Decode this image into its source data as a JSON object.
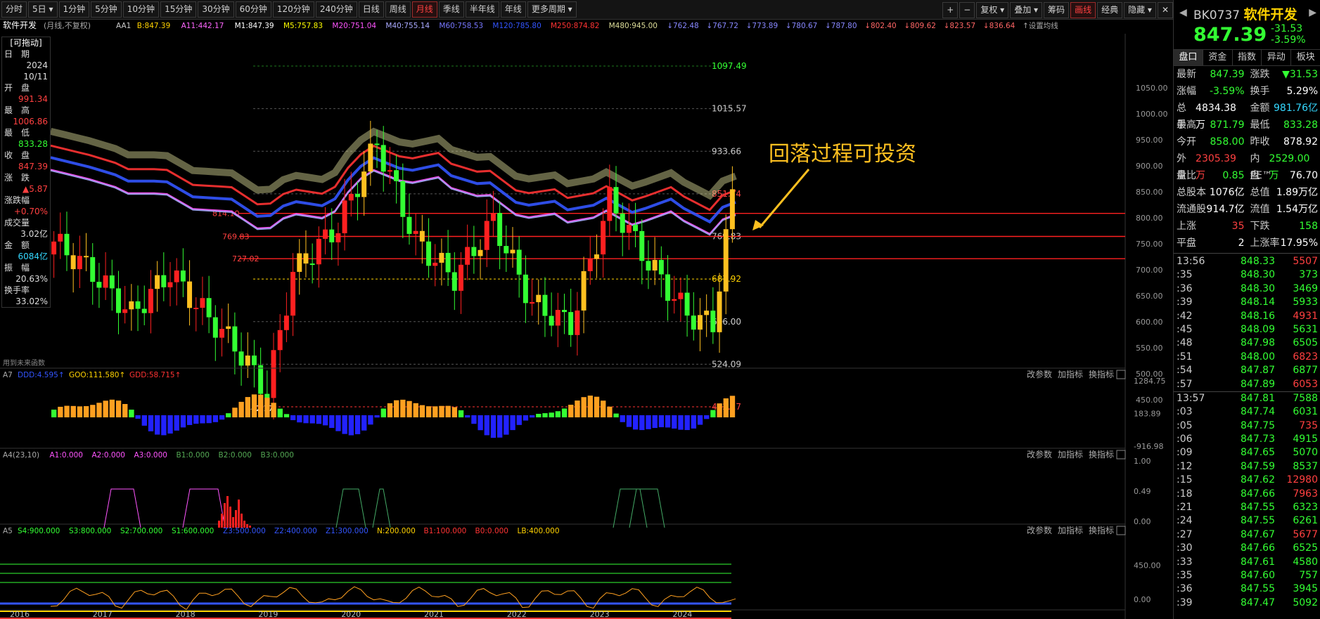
{
  "toolbar": {
    "periods": [
      "分时",
      "5日",
      "1分钟",
      "5分钟",
      "10分钟",
      "15分钟",
      "30分钟",
      "60分钟",
      "120分钟",
      "240分钟",
      "日线",
      "周线",
      "月线",
      "季线",
      "半年线",
      "年线",
      "更多周期"
    ],
    "active_period": "月线",
    "right_buttons": [
      "+",
      "−",
      "复权",
      "叠加",
      "筹码",
      "画线",
      "经典",
      "隐藏"
    ],
    "active_right": "画线"
  },
  "chart_header": {
    "name": "软件开发",
    "mode": "(月线,不复权)",
    "ma_items": [
      {
        "t": "AA1",
        "c": "#cccccc"
      },
      {
        "t": "B:847.39",
        "c": "#ffd200"
      },
      {
        "t": "A11:442.17",
        "c": "#ff66ff"
      },
      {
        "t": "M1:847.39",
        "c": "#ffffff"
      },
      {
        "t": "M5:757.83",
        "c": "#ffff00"
      },
      {
        "t": "M20:751.04",
        "c": "#ff55ff"
      },
      {
        "t": "M40:755.14",
        "c": "#aaaaff"
      },
      {
        "t": "M60:758.53",
        "c": "#7777ff"
      },
      {
        "t": "M120:785.80",
        "c": "#3355ff"
      },
      {
        "t": "M250:874.82",
        "c": "#ff3333"
      },
      {
        "t": "M480:945.00",
        "c": "#dddd99"
      },
      {
        "t": "↓762.48",
        "c": "#8888ff"
      },
      {
        "t": "↓767.72",
        "c": "#8888ff"
      },
      {
        "t": "↓773.89",
        "c": "#8888ff"
      },
      {
        "t": "↓780.67",
        "c": "#8888ff"
      },
      {
        "t": "↓787.80",
        "c": "#8888ff"
      },
      {
        "t": "↓802.40",
        "c": "#ff6666"
      },
      {
        "t": "↓809.62",
        "c": "#ff6666"
      },
      {
        "t": "↓823.57",
        "c": "#ff6666"
      },
      {
        "t": "↓836.64",
        "c": "#ff6666"
      },
      {
        "t": "↑设置均线",
        "c": "#aaaaaa"
      }
    ]
  },
  "infobox": {
    "title": "[可拖动]",
    "rows": [
      {
        "label": "日　期",
        "value": "2024",
        "value2": "10/11",
        "color": "#dddddd"
      },
      {
        "label": "开　盘",
        "value": "991.34",
        "color": "#ff4040"
      },
      {
        "label": "最　高",
        "value": "1006.86",
        "color": "#ff4040"
      },
      {
        "label": "最　低",
        "value": "833.28",
        "color": "#33ff33"
      },
      {
        "label": "收　盘",
        "value": "847.39",
        "color": "#ff4040"
      },
      {
        "label": "涨　跌",
        "value": "▲5.87",
        "color": "#ff4040"
      },
      {
        "label": "涨跌幅",
        "value": "+0.70%",
        "color": "#ff4040"
      },
      {
        "label": "成交量",
        "value": "3.02亿",
        "color": "#dddddd"
      },
      {
        "label": "金　额",
        "value": "6084亿",
        "color": "#34d8ff"
      },
      {
        "label": "振　幅",
        "value": "20.63%",
        "color": "#dddddd"
      },
      {
        "label": "换手率",
        "value": "33.02%",
        "color": "#dddddd"
      }
    ]
  },
  "main_chart": {
    "y_ticks": [
      "1050.00",
      "1000.00",
      "950.00",
      "900.00",
      "850.00",
      "800.00",
      "750.00",
      "700.00",
      "650.00",
      "600.00",
      "550.00",
      "500.00",
      "450.00"
    ],
    "price_labels": [
      "1097.49",
      "1015.57",
      "933.66",
      "851.74",
      "769.83",
      "687.92",
      "606.00",
      "524.09",
      "442.17"
    ],
    "left_levels": [
      "814.10",
      "769.83",
      "727.02"
    ],
    "low_marker": "442.17",
    "annotation": "回落过程可投资",
    "footnote": "用到未来函数"
  },
  "x_axis": [
    "2016",
    "2017",
    "2018",
    "2019",
    "2020",
    "2021",
    "2022",
    "2023",
    "2024"
  ],
  "panels": [
    {
      "name": "A7",
      "items": [
        {
          "t": "A7",
          "c": "#aaaaaa"
        },
        {
          "t": "DDD:4.595↑",
          "c": "#3355ff"
        },
        {
          "t": "GOO:111.580↑",
          "c": "#ffd200"
        },
        {
          "t": "GDD:58.715↑",
          "c": "#ff3333"
        }
      ],
      "y_ticks": [
        "1284.75",
        "183.89",
        "-916.98"
      ]
    },
    {
      "name": "A4",
      "items": [
        {
          "t": "A4(23,10)",
          "c": "#aaaaaa"
        },
        {
          "t": "A1:0.000",
          "c": "#ff55ff"
        },
        {
          "t": "A2:0.000",
          "c": "#ff55ff"
        },
        {
          "t": "A3:0.000",
          "c": "#ff55ff"
        },
        {
          "t": "B1:0.000",
          "c": "#55aa55"
        },
        {
          "t": "B2:0.000",
          "c": "#55aa55"
        },
        {
          "t": "B3:0.000",
          "c": "#55aa55"
        }
      ],
      "y_ticks": [
        "1.00",
        "0.49",
        "0.00"
      ]
    },
    {
      "name": "A5",
      "items": [
        {
          "t": "A5",
          "c": "#aaaaaa"
        },
        {
          "t": "S4:900.000",
          "c": "#33ff33"
        },
        {
          "t": "S3:800.000",
          "c": "#33ff33"
        },
        {
          "t": "S2:700.000",
          "c": "#33ff33"
        },
        {
          "t": "S1:600.000",
          "c": "#33ff33"
        },
        {
          "t": "Z3:500.000",
          "c": "#3355ff"
        },
        {
          "t": "Z2:400.000",
          "c": "#3355ff"
        },
        {
          "t": "Z1:300.000",
          "c": "#3355ff"
        },
        {
          "t": "N:200.000",
          "c": "#ffd200"
        },
        {
          "t": "B1:100.000",
          "c": "#ff3333"
        },
        {
          "t": "B0:0.000",
          "c": "#ff3333"
        },
        {
          "t": "LB:400.000",
          "c": "#ffd200"
        }
      ],
      "y_ticks": [
        "450.00",
        "0.00"
      ]
    }
  ],
  "panel_buttons": [
    "改参数",
    "加指标",
    "换指标"
  ],
  "quote": {
    "code": "BK0737",
    "name": "软件开发",
    "price": "847.39",
    "change": "-31.53",
    "change_pct": "-3.59%",
    "tabs": [
      "盘口",
      "资金",
      "指数",
      "异动",
      "板块"
    ],
    "active_tab": "盘口",
    "rows": [
      [
        {
          "l": "最新",
          "v": "847.39",
          "c": "green"
        },
        {
          "l": "涨跌",
          "v": "▼31.53",
          "c": "green"
        }
      ],
      [
        {
          "l": "涨幅",
          "v": "-3.59%",
          "c": "green"
        },
        {
          "l": "换手",
          "v": "5.29%",
          "c": "white"
        }
      ],
      [
        {
          "l": "总手",
          "v": "4834.38万",
          "c": "white"
        },
        {
          "l": "金额",
          "v": "981.76亿",
          "c": "cyan"
        }
      ],
      [
        {
          "l": "最高",
          "v": "871.79",
          "c": "green"
        },
        {
          "l": "最低",
          "v": "833.28",
          "c": "green"
        }
      ],
      [
        {
          "l": "今开",
          "v": "858.00",
          "c": "green"
        },
        {
          "l": "昨收",
          "v": "878.92",
          "c": "white"
        }
      ],
      [
        {
          "l": "外盘",
          "v": "2305.39万",
          "c": "red"
        },
        {
          "l": "内盘",
          "v": "2529.00万",
          "c": "green"
        }
      ],
      [
        {
          "l": "量比",
          "v": "0.85",
          "c": "green"
        },
        {
          "l": "PE™",
          "v": "76.70",
          "c": "white"
        }
      ],
      [
        {
          "l": "总股本",
          "v": "1076亿",
          "c": "white"
        },
        {
          "l": "总值",
          "v": "1.89万亿",
          "c": "white"
        }
      ],
      [
        {
          "l": "流通股",
          "v": "914.7亿",
          "c": "white"
        },
        {
          "l": "流值",
          "v": "1.54万亿",
          "c": "white"
        }
      ],
      [
        {
          "l": "上涨",
          "v": "35",
          "c": "red"
        },
        {
          "l": "下跌",
          "v": "158",
          "c": "green"
        }
      ],
      [
        {
          "l": "平盘",
          "v": "2",
          "c": "white"
        },
        {
          "l": "上涨率",
          "v": "17.95%",
          "c": "white"
        }
      ]
    ],
    "ticks": [
      {
        "t": "13:56",
        "p": "848.33",
        "v": "5507",
        "vc": "red"
      },
      {
        "t": ":35",
        "p": "848.30",
        "v": "373",
        "vc": "green"
      },
      {
        "t": ":36",
        "p": "848.30",
        "v": "3469",
        "vc": "green"
      },
      {
        "t": ":39",
        "p": "848.14",
        "v": "5933",
        "vc": "green"
      },
      {
        "t": ":42",
        "p": "848.16",
        "v": "4931",
        "vc": "red"
      },
      {
        "t": ":45",
        "p": "848.09",
        "v": "5631",
        "vc": "green"
      },
      {
        "t": ":48",
        "p": "847.98",
        "v": "6505",
        "vc": "green"
      },
      {
        "t": ":51",
        "p": "848.00",
        "v": "6823",
        "vc": "red"
      },
      {
        "t": ":54",
        "p": "847.87",
        "v": "6877",
        "vc": "green"
      },
      {
        "t": ":57",
        "p": "847.89",
        "v": "6053",
        "vc": "red"
      },
      {
        "t": "13:57",
        "p": "847.81",
        "v": "7588",
        "vc": "green"
      },
      {
        "t": ":03",
        "p": "847.74",
        "v": "6031",
        "vc": "green"
      },
      {
        "t": ":05",
        "p": "847.75",
        "v": "735",
        "vc": "red"
      },
      {
        "t": ":06",
        "p": "847.73",
        "v": "4915",
        "vc": "green"
      },
      {
        "t": ":09",
        "p": "847.65",
        "v": "5070",
        "vc": "green"
      },
      {
        "t": ":12",
        "p": "847.59",
        "v": "8537",
        "vc": "green"
      },
      {
        "t": ":15",
        "p": "847.62",
        "v": "12980",
        "vc": "red"
      },
      {
        "t": ":18",
        "p": "847.66",
        "v": "7963",
        "vc": "red"
      },
      {
        "t": ":21",
        "p": "847.55",
        "v": "6323",
        "vc": "green"
      },
      {
        "t": ":24",
        "p": "847.55",
        "v": "6261",
        "vc": "green"
      },
      {
        "t": ":27",
        "p": "847.67",
        "v": "5677",
        "vc": "red"
      },
      {
        "t": ":30",
        "p": "847.66",
        "v": "6525",
        "vc": "green"
      },
      {
        "t": ":33",
        "p": "847.61",
        "v": "4580",
        "vc": "green"
      },
      {
        "t": ":35",
        "p": "847.60",
        "v": "757",
        "vc": "green"
      },
      {
        "t": ":36",
        "p": "847.55",
        "v": "3945",
        "vc": "green"
      },
      {
        "t": ":39",
        "p": "847.47",
        "v": "5092",
        "vc": "green"
      }
    ]
  }
}
